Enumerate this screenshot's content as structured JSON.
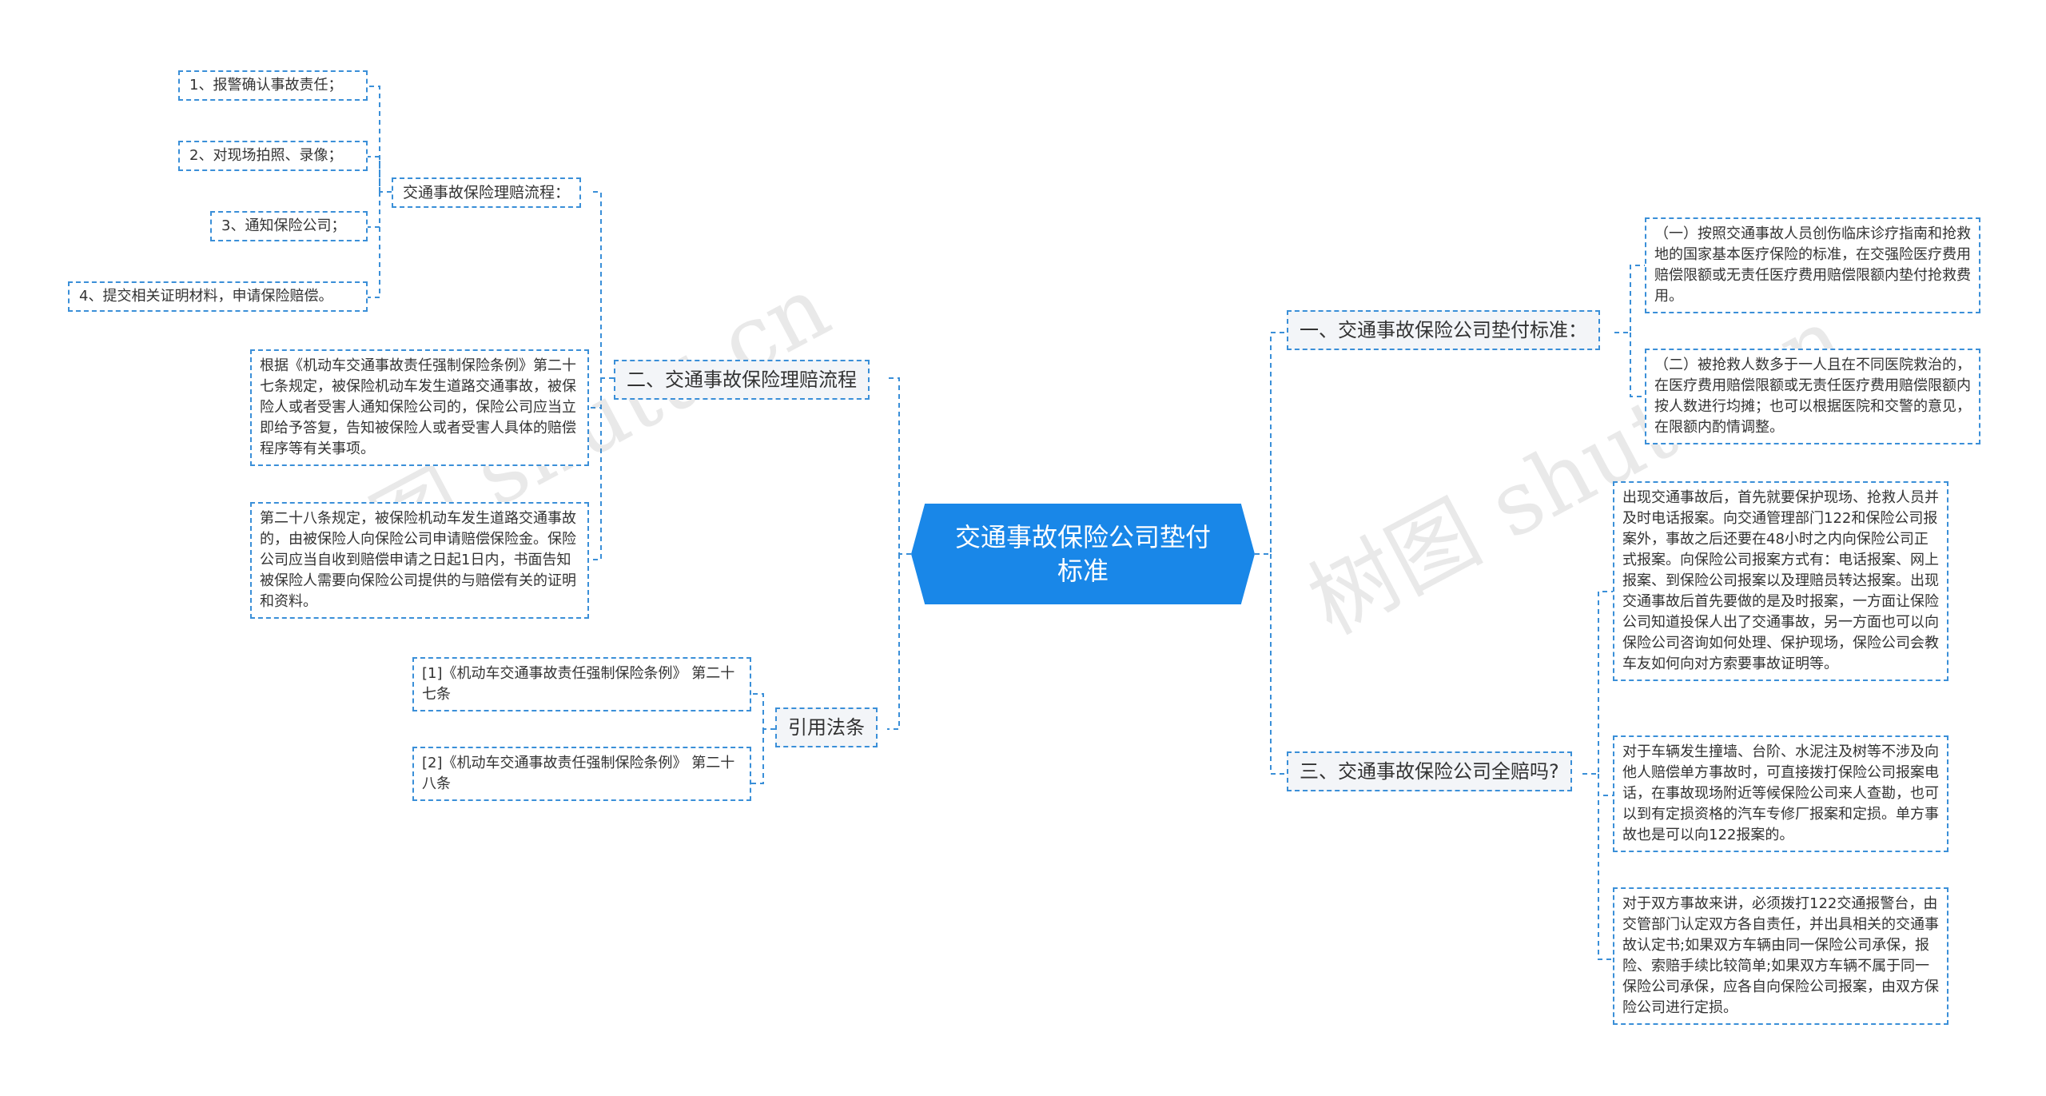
{
  "root": {
    "title": "交通事故保险公司垫付标准"
  },
  "left": {
    "branch2": {
      "label": "二、交通事故保险理赔流程",
      "process": {
        "label": "交通事故保险理赔流程：",
        "steps": [
          "1、报警确认事故责任；",
          "2、对现场拍照、录像；",
          "3、通知保险公司；",
          "4、提交相关证明材料，申请保险赔偿。"
        ]
      },
      "para1": "根据《机动车交通事故责任强制保险条例》第二十七条规定，被保险机动车发生道路交通事故，被保险人或者受害人通知保险公司的，保险公司应当立即给予答复，告知被保险人或者受害人具体的赔偿程序等有关事项。",
      "para2": "第二十八条规定，被保险机动车发生道路交通事故的，由被保险人向保险公司申请赔偿保险金。保险公司应当自收到赔偿申请之日起1日内，书面告知被保险人需要向保险公司提供的与赔偿有关的证明和资料。"
    },
    "cite": {
      "label": "引用法条",
      "items": [
        "[1]《机动车交通事故责任强制保险条例》 第二十七条",
        "[2]《机动车交通事故责任强制保险条例》 第二十八条"
      ]
    }
  },
  "right": {
    "branch1": {
      "label": "一、交通事故保险公司垫付标准：",
      "items": [
        "（一）按照交通事故人员创伤临床诊疗指南和抢救地的国家基本医疗保险的标准，在交强险医疗费用赔偿限额或无责任医疗费用赔偿限额内垫付抢救费用。",
        "（二）被抢救人数多于一人且在不同医院救治的，在医疗费用赔偿限额或无责任医疗费用赔偿限额内按人数进行均摊；也可以根据医院和交警的意见，在限额内酌情调整。"
      ]
    },
    "branch3": {
      "label": "三、交通事故保险公司全赔吗?",
      "items": [
        "出现交通事故后，首先就要保护现场、抢救人员并及时电话报案。向交通管理部门122和保险公司报案外，事故之后还要在48小时之内向保险公司正式报案。向保险公司报案方式有：电话报案、网上报案、到保险公司报案以及理赔员转达报案。出现交通事故后首先要做的是及时报案，一方面让保险公司知道投保人出了交通事故，另一方面也可以向保险公司咨询如何处理、保护现场，保险公司会教车友如何向对方索要事故证明等。",
        "对于车辆发生撞墙、台阶、水泥注及树等不涉及向他人赔偿单方事故时，可直接拨打保险公司报案电话，在事故现场附近等候保险公司来人查勘，也可以到有定损资格的汽车专修厂报案和定损。单方事故也是可以向122报案的。",
        "对于双方事故来讲，必须拨打122交通报警台，由交管部门认定双方各自责任，并出具相关的交通事故认定书;如果双方车辆由同一保险公司承保，报险、索赔手续比较简单;如果双方车辆不属于同一保险公司承保，应各自向保险公司报案，由双方保险公司进行定损。"
      ]
    }
  },
  "watermark": "树图 shutu.cn",
  "colors": {
    "accent": "#1987e8",
    "line": "#3a8fd8"
  }
}
